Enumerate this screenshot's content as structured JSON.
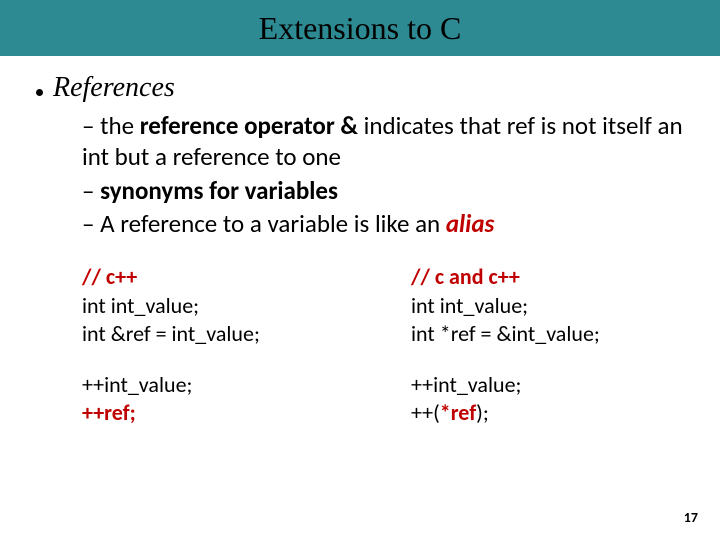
{
  "title": "Extensions to C",
  "heading": "References",
  "sub": {
    "item1_prefix": "– the ",
    "item1_bold": "reference operator &",
    "item1_rest": " indicates that ref is not itself an int but a reference to one",
    "item2_prefix": "– ",
    "item2_bold": "synonyms for variables",
    "item3_prefix": "– A reference to a variable is like an ",
    "item3_alias": "alias"
  },
  "code_left": {
    "head": "// c++",
    "l1": "int int_value;",
    "l2": "int &ref = int_value;",
    "l3": "++int_value;",
    "l4": "++ref;"
  },
  "code_right": {
    "head": "// c and c++",
    "l1": "int int_value;",
    "l2": "int *ref = &int_value;",
    "l3": "++int_value;",
    "l4_a": "++(",
    "l4_b": "*ref",
    "l4_c": ");"
  },
  "page_number": "17"
}
